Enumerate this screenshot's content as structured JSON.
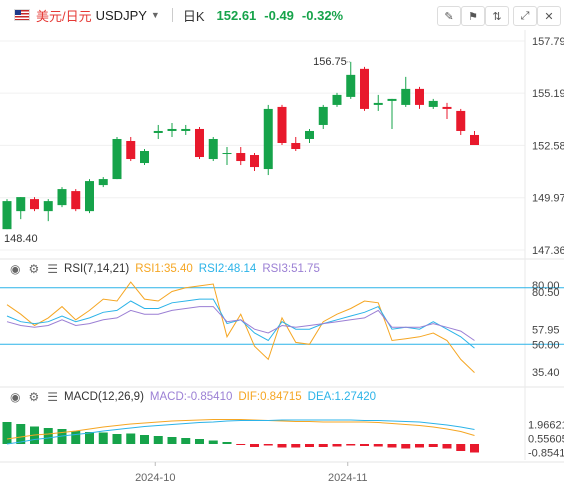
{
  "toolbar": {
    "symbol_cn": "美元/日元",
    "symbol": "USDJPY",
    "period": "日K",
    "price": "152.61",
    "change": "-0.49",
    "change_pct": "-0.32%"
  },
  "colors": {
    "up": "#16a34a",
    "down": "#e8192c",
    "rsi1": "#f5a623",
    "rsi2": "#2bb3e8",
    "rsi3": "#9b7fd4",
    "dif": "#f5a623",
    "dea": "#2bb3e8",
    "ref_line": "#2bb3e8"
  },
  "chart_data": [
    {
      "type": "candlestick",
      "name": "USDJPY 日K",
      "y_ticks": [
        "157.79",
        "155.19",
        "152.58",
        "149.97",
        "147.36"
      ],
      "ylim": [
        147.36,
        157.79
      ],
      "annotations": {
        "high": "156.75",
        "low": "148.40"
      },
      "candles": [
        {
          "o": 148.4,
          "h": 149.9,
          "l": 148.4,
          "c": 149.8
        },
        {
          "o": 149.3,
          "h": 150.0,
          "l": 148.9,
          "c": 150.0
        },
        {
          "o": 149.9,
          "h": 150.0,
          "l": 149.3,
          "c": 149.4
        },
        {
          "o": 149.3,
          "h": 149.9,
          "l": 148.8,
          "c": 149.8
        },
        {
          "o": 149.6,
          "h": 150.5,
          "l": 149.5,
          "c": 150.4
        },
        {
          "o": 150.3,
          "h": 150.4,
          "l": 149.3,
          "c": 149.4
        },
        {
          "o": 149.3,
          "h": 150.9,
          "l": 149.2,
          "c": 150.8
        },
        {
          "o": 150.6,
          "h": 151.0,
          "l": 150.5,
          "c": 150.9
        },
        {
          "o": 150.9,
          "h": 153.0,
          "l": 150.9,
          "c": 152.9
        },
        {
          "o": 152.8,
          "h": 153.0,
          "l": 151.8,
          "c": 151.9
        },
        {
          "o": 151.7,
          "h": 152.4,
          "l": 151.6,
          "c": 152.3
        },
        {
          "o": 153.2,
          "h": 153.6,
          "l": 152.9,
          "c": 153.3
        },
        {
          "o": 153.3,
          "h": 153.7,
          "l": 153.0,
          "c": 153.4
        },
        {
          "o": 153.3,
          "h": 153.6,
          "l": 153.1,
          "c": 153.4
        },
        {
          "o": 153.4,
          "h": 153.5,
          "l": 151.9,
          "c": 152.0
        },
        {
          "o": 151.9,
          "h": 153.0,
          "l": 151.8,
          "c": 152.9
        },
        {
          "o": 152.2,
          "h": 152.5,
          "l": 151.6,
          "c": 152.2
        },
        {
          "o": 152.2,
          "h": 152.5,
          "l": 151.6,
          "c": 151.8
        },
        {
          "o": 152.1,
          "h": 152.2,
          "l": 151.3,
          "c": 151.5
        },
        {
          "o": 151.4,
          "h": 154.6,
          "l": 151.1,
          "c": 154.4
        },
        {
          "o": 154.5,
          "h": 154.6,
          "l": 152.6,
          "c": 152.7
        },
        {
          "o": 152.7,
          "h": 153.0,
          "l": 152.3,
          "c": 152.4
        },
        {
          "o": 152.9,
          "h": 153.4,
          "l": 152.7,
          "c": 153.3
        },
        {
          "o": 153.6,
          "h": 154.6,
          "l": 153.4,
          "c": 154.5
        },
        {
          "o": 154.6,
          "h": 155.2,
          "l": 154.5,
          "c": 155.1
        },
        {
          "o": 155.0,
          "h": 156.75,
          "l": 154.9,
          "c": 156.1
        },
        {
          "o": 156.4,
          "h": 156.5,
          "l": 154.3,
          "c": 154.4
        },
        {
          "o": 154.6,
          "h": 155.1,
          "l": 154.3,
          "c": 154.7
        },
        {
          "o": 154.8,
          "h": 154.9,
          "l": 153.4,
          "c": 154.9
        },
        {
          "o": 154.6,
          "h": 156.0,
          "l": 154.5,
          "c": 155.4
        },
        {
          "o": 155.4,
          "h": 155.5,
          "l": 154.4,
          "c": 154.6
        },
        {
          "o": 154.5,
          "h": 154.9,
          "l": 154.4,
          "c": 154.8
        },
        {
          "o": 154.5,
          "h": 154.7,
          "l": 153.9,
          "c": 154.4
        },
        {
          "o": 154.3,
          "h": 154.4,
          "l": 153.1,
          "c": 153.3
        },
        {
          "o": 153.1,
          "h": 153.3,
          "l": 152.6,
          "c": 152.6
        }
      ]
    },
    {
      "type": "line",
      "name": "RSI(7,14,21)",
      "legend": [
        {
          "label": "RSI(7,14,21)"
        },
        {
          "label": "RSI1:35.40"
        },
        {
          "label": "RSI2:48.14"
        },
        {
          "label": "RSI3:51.75"
        }
      ],
      "y_ticks": [
        "80.00",
        "80.50",
        "57.95",
        "50.00",
        "35.40"
      ],
      "reference_lines": [
        80,
        50
      ],
      "series": [
        {
          "name": "RSI1",
          "values": [
            71,
            66,
            60,
            64,
            70,
            63,
            68,
            74,
            73,
            83,
            74,
            73,
            78,
            80,
            81,
            82,
            54,
            66,
            49,
            42,
            64,
            51,
            50,
            62,
            66,
            69,
            73,
            72,
            52,
            53,
            54,
            56,
            52,
            42,
            35
          ]
        },
        {
          "name": "RSI2",
          "values": [
            65,
            62,
            61,
            62,
            65,
            62,
            64,
            67,
            68,
            73,
            69,
            69,
            72,
            73,
            74,
            74,
            61,
            63,
            56,
            52,
            62,
            58,
            58,
            61,
            63,
            65,
            67,
            70,
            58,
            59,
            58,
            62,
            58,
            54,
            48
          ]
        },
        {
          "name": "RSI3",
          "values": [
            62,
            60,
            59,
            60,
            63,
            60,
            61,
            63,
            64,
            68,
            66,
            66,
            68,
            69,
            70,
            70,
            62,
            63,
            58,
            56,
            60,
            59,
            60,
            61,
            62,
            63,
            64,
            68,
            59,
            59,
            59,
            61,
            59,
            57,
            52
          ]
        }
      ]
    },
    {
      "type": "bar",
      "name": "MACD(12,26,9)",
      "legend": [
        {
          "label": "MACD(12,26,9)"
        },
        {
          "label": "MACD:-0.85410"
        },
        {
          "label": "DIF:0.84715"
        },
        {
          "label": "DEA:1.27420"
        }
      ],
      "y_ticks": [
        "1.96621",
        "0.55605",
        "-0.85410"
      ],
      "x_ticks": [
        "2024-10",
        "2024-11"
      ],
      "histogram": [
        2.2,
        2.0,
        1.75,
        1.6,
        1.5,
        1.3,
        1.2,
        1.15,
        1.0,
        1.05,
        0.9,
        0.8,
        0.7,
        0.6,
        0.5,
        0.35,
        0.2,
        -0.05,
        -0.3,
        -0.15,
        -0.35,
        -0.35,
        -0.3,
        -0.3,
        -0.25,
        -0.15,
        -0.2,
        -0.25,
        -0.35,
        -0.45,
        -0.35,
        -0.3,
        -0.45,
        -0.7,
        -0.85
      ],
      "series": [
        {
          "name": "DIF",
          "values": [
            0.5,
            0.7,
            0.9,
            1.0,
            1.15,
            1.3,
            1.5,
            1.7,
            1.85,
            2.0,
            2.1,
            2.2,
            2.3,
            2.35,
            2.4,
            2.45,
            2.45,
            2.45,
            2.4,
            2.35,
            2.3,
            2.25,
            2.25,
            2.2,
            2.2,
            2.2,
            2.2,
            2.15,
            2.05,
            1.95,
            1.85,
            1.7,
            1.5,
            1.25,
            0.85
          ]
        },
        {
          "name": "DEA",
          "values": [
            0.0,
            0.2,
            0.45,
            0.6,
            0.8,
            0.95,
            1.1,
            1.3,
            1.45,
            1.6,
            1.75,
            1.85,
            1.95,
            2.05,
            2.15,
            2.2,
            2.3,
            2.35,
            2.35,
            2.35,
            2.4,
            2.4,
            2.4,
            2.4,
            2.4,
            2.4,
            2.35,
            2.35,
            2.3,
            2.25,
            2.2,
            2.05,
            1.9,
            1.7,
            1.45
          ]
        }
      ]
    }
  ]
}
